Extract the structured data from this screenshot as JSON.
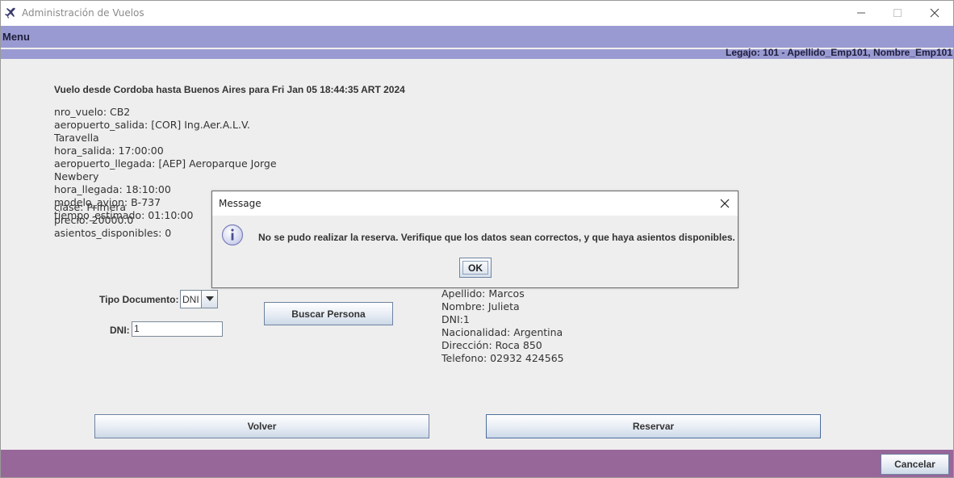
{
  "window": {
    "title": "Administración de Vuelos"
  },
  "menubar": {
    "menu_label": "Menu"
  },
  "userbar": {
    "legajo": "Legajo: 101 - Apellido_Emp101, Nombre_Emp101"
  },
  "flight": {
    "heading": "Vuelo desde Cordoba hasta Buenos Aires para Fri Jan 05 18:44:35 ART 2024",
    "lines": [
      "nro_vuelo: CB2",
      "aeropuerto_salida: [COR] Ing.Aer.A.L.V.",
      "Taravella",
      "hora_salida: 17:00:00",
      "aeropuerto_llegada: [AEP] Aeroparque Jorge",
      "Newbery",
      "hora_llegada: 18:10:00",
      "modelo_avion: B-737",
      "tiempo_estimado: 01:10:00",
      "asientos_disponibles: 0"
    ],
    "overlap_lines": [
      "clase: Primera",
      "precio: 20000.0"
    ]
  },
  "search": {
    "tipo_documento_label": "Tipo Documento:",
    "tipo_documento_value": "DNI",
    "dni_label": "DNI:",
    "dni_value": "1",
    "buscar_label": "Buscar Persona"
  },
  "person": {
    "lines": [
      "Apellido: Marcos",
      "Nombre: Julieta",
      "DNI:1",
      "Nacionalidad: Argentina",
      "Dirección: Roca 850",
      "Telefono: 02932 424565"
    ]
  },
  "actions": {
    "volver_label": "Volver",
    "reservar_label": "Reservar",
    "cancelar_label": "Cancelar"
  },
  "dialog": {
    "title": "Message",
    "message": "No se pudo realizar la reserva. Verifique que los datos sean correctos, y que haya asientos disponibles.",
    "ok_label": "OK"
  },
  "colors": {
    "menubar": "#9a9ad2",
    "footer": "#976799",
    "background": "#eeeeee"
  }
}
